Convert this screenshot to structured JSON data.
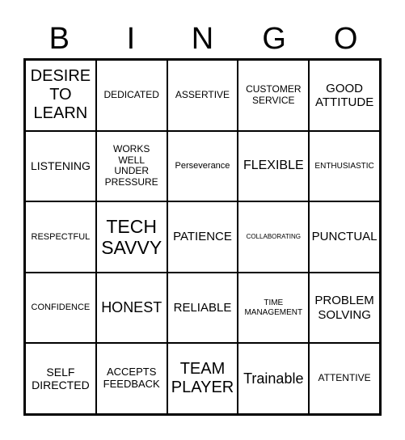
{
  "header": [
    "B",
    "I",
    "N",
    "G",
    "O"
  ],
  "cells": [
    "DESIRE TO LEARN",
    "DEDICATED",
    "ASSERTIVE",
    "CUSTOMER SERVICE",
    "GOOD ATTITUDE",
    "LISTENING",
    "WORKS WELL UNDER PRESSURE",
    "Perseverance",
    "FLEXIBLE",
    "ENTHUSIASTIC",
    "RESPECTFUL",
    "TECH SAVVY",
    "PATIENCE",
    "COLLABORATING",
    "PUNCTUAL",
    "CONFIDENCE",
    "HONEST",
    "RELIABLE",
    "TIME MANAGEMENT",
    "PROBLEM SOLVING",
    "SELF DIRECTED",
    "ACCEPTS FEEDBACK",
    "TEAM PLAYER",
    "Trainable",
    "ATTENTIVE"
  ]
}
